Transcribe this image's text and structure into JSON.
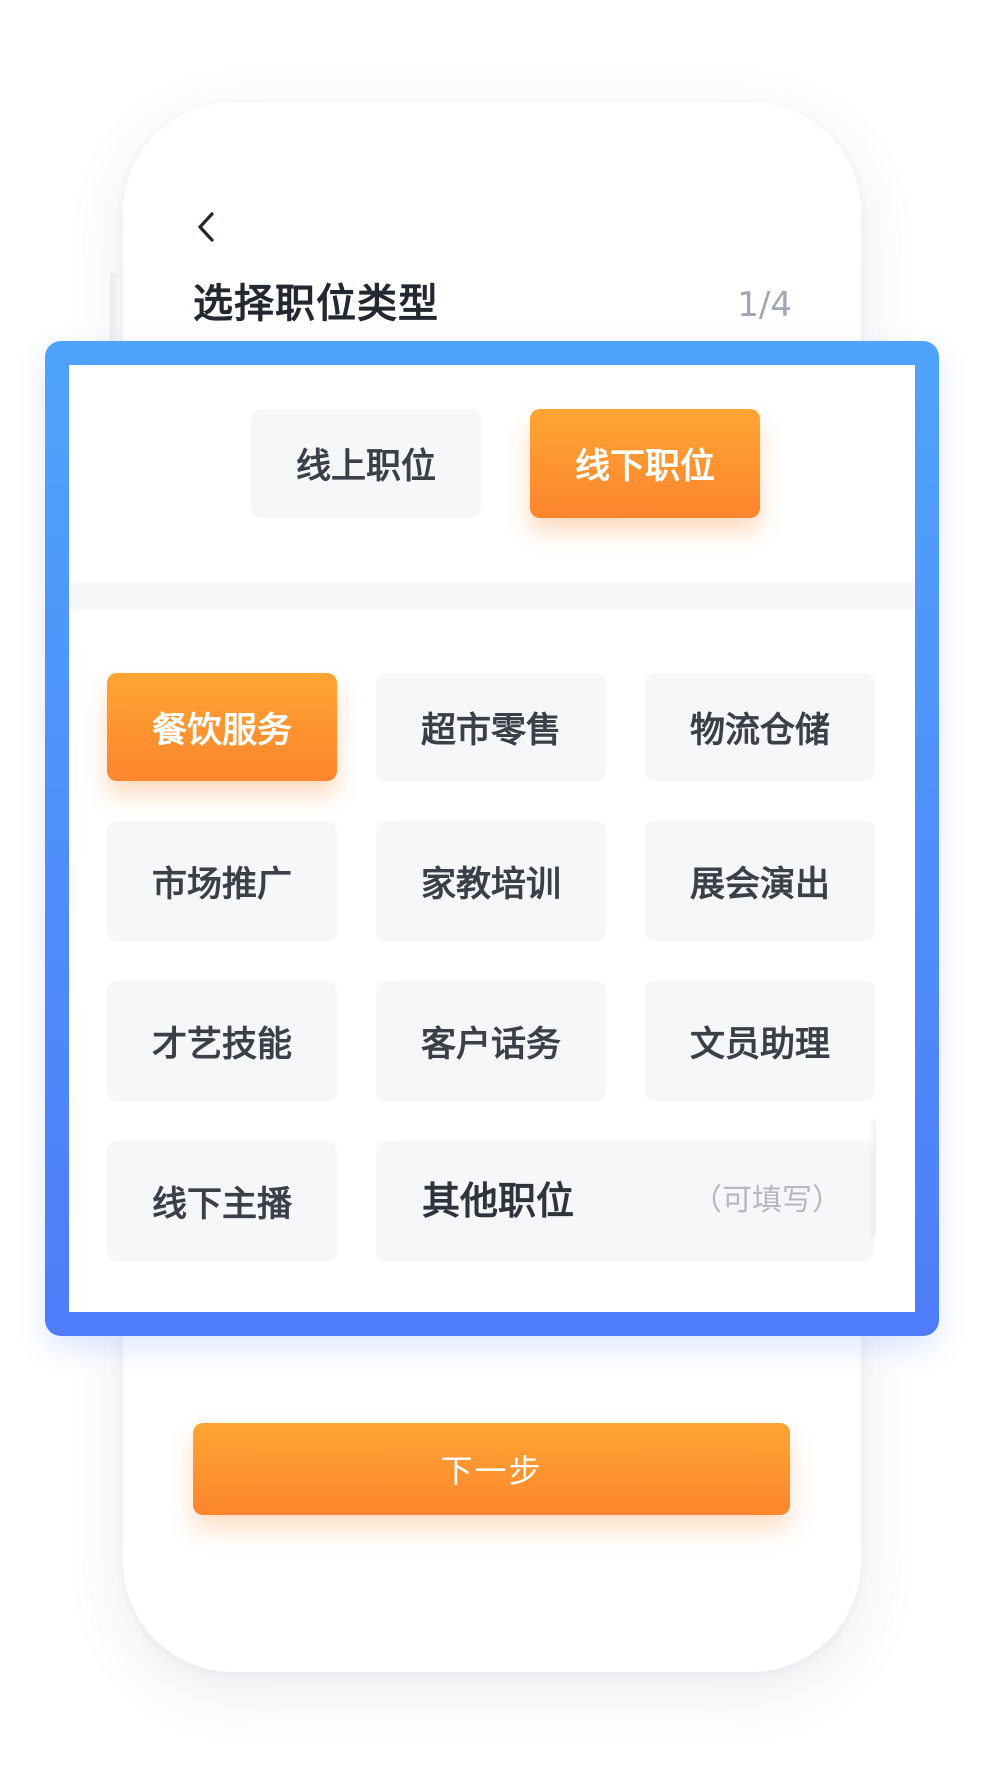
{
  "header": {
    "back_icon": "chevron-left-icon",
    "title": "选择职位类型",
    "step": "1/4"
  },
  "modes": {
    "online": "线上职位",
    "offline": "线下职位",
    "selected": "offline"
  },
  "categories": {
    "row1": [
      "餐饮服务",
      "超市零售",
      "物流仓储"
    ],
    "row2": [
      "市场推广",
      "家教培训",
      "展会演出"
    ],
    "row3": [
      "才艺技能",
      "客户话务",
      "文员助理"
    ],
    "row4": [
      "线下主播"
    ],
    "selected": "餐饮服务"
  },
  "other": {
    "label": "其他职位",
    "hint": "（可填写）"
  },
  "footer": {
    "next_label": "下一步"
  },
  "colors": {
    "accent_orange": "#fd852e",
    "highlight_blue": "#4f7cf9",
    "tile_bg": "#f6f7f9"
  }
}
